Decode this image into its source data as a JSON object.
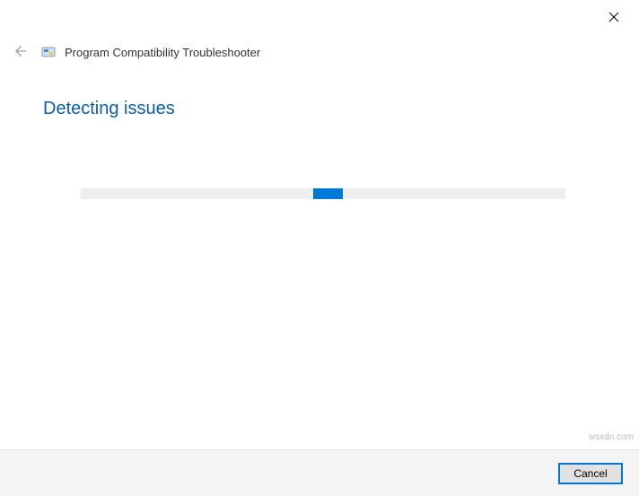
{
  "window": {
    "title": "Program Compatibility Troubleshooter"
  },
  "main": {
    "heading": "Detecting issues",
    "progress": {
      "chunk_left_pct": 48,
      "chunk_width_pct": 6
    }
  },
  "footer": {
    "cancel_label": "Cancel"
  },
  "watermark": "wsxdn.com"
}
